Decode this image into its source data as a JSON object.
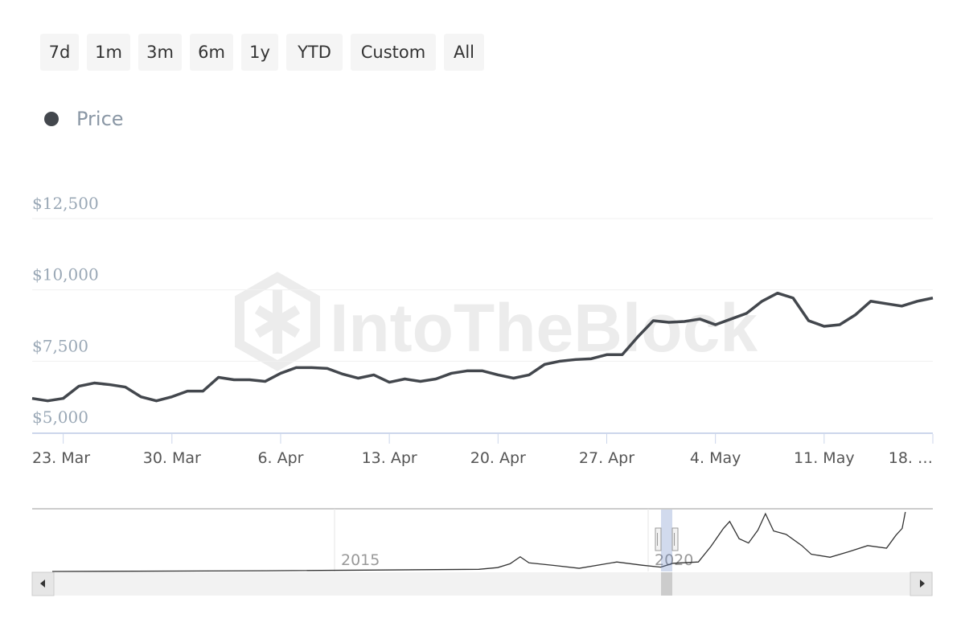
{
  "range_selector": {
    "buttons": [
      "7d",
      "1m",
      "3m",
      "6m",
      "1y",
      "YTD",
      "Custom",
      "All"
    ]
  },
  "legend": {
    "label": "Price",
    "color": "#43474d"
  },
  "watermark": "IntoTheBlock",
  "chart_data": {
    "type": "line",
    "title": "",
    "xlabel": "",
    "ylabel": "",
    "ylim": [
      5000,
      12500
    ],
    "y_ticks": [
      5000,
      7500,
      10000,
      12500
    ],
    "y_tick_labels": [
      "$5,000",
      "$7,500",
      "$10,000",
      "$12,500"
    ],
    "x_tick_labels": [
      "23. Mar",
      "30. Mar",
      "6. Apr",
      "13. Apr",
      "20. Apr",
      "27. Apr",
      "4. May",
      "11. May",
      "18. …"
    ],
    "x_ticks": [
      "2020-03-23",
      "2020-03-30",
      "2020-04-06",
      "2020-04-13",
      "2020-04-20",
      "2020-04-27",
      "2020-05-04",
      "2020-05-11",
      "2020-05-18"
    ],
    "grid": true,
    "legend_position": "top-left",
    "series": [
      {
        "name": "Price",
        "color": "#43474d",
        "start_date": "2020-03-21",
        "interval": "1 day",
        "values": [
          6193,
          6108,
          6193,
          6619,
          6733,
          6676,
          6591,
          6250,
          6108,
          6250,
          6449,
          6449,
          6932,
          6847,
          6847,
          6790,
          7074,
          7273,
          7273,
          7244,
          7045,
          6903,
          7017,
          6761,
          6875,
          6790,
          6875,
          7074,
          7159,
          7159,
          7017,
          6903,
          7017,
          7386,
          7500,
          7557,
          7585,
          7727,
          7727,
          8352,
          8920,
          8864,
          8892,
          8977,
          8778,
          8977,
          9176,
          9602,
          9886,
          9716,
          8920,
          8722,
          8778,
          9119,
          9602,
          9517,
          9432,
          9602,
          9716
        ]
      }
    ],
    "navigator": {
      "x_tick_labels": [
        "2015",
        "2020"
      ],
      "x_ticks": [
        2015,
        2020
      ],
      "selected_range": [
        "2020-03-21",
        "2020-05-18"
      ],
      "series": {
        "years": [
          2010.5,
          2013.9,
          2017.3,
          2017.6,
          2017.8,
          2017.96,
          2018.1,
          2018.5,
          2018.9,
          2019.5,
          2019.9,
          2020.2,
          2020.4,
          2020.8,
          2021.0,
          2021.2,
          2021.3,
          2021.45,
          2021.6,
          2021.75,
          2021.87,
          2022.0,
          2022.2,
          2022.45,
          2022.6,
          2022.9,
          2023.2,
          2023.5,
          2023.8,
          2023.95,
          2024.05,
          2024.1
        ],
        "values": [
          0,
          800,
          2500,
          4500,
          9000,
          17000,
          10000,
          7000,
          3700,
          11000,
          7300,
          5000,
          9500,
          11000,
          29000,
          50000,
          58000,
          38000,
          33000,
          48000,
          67000,
          47000,
          43000,
          30000,
          20000,
          16500,
          23000,
          30000,
          27000,
          42000,
          50000,
          69000
        ]
      }
    }
  },
  "scrollbar": {
    "left_arrow": "◀",
    "right_arrow": "▶"
  }
}
